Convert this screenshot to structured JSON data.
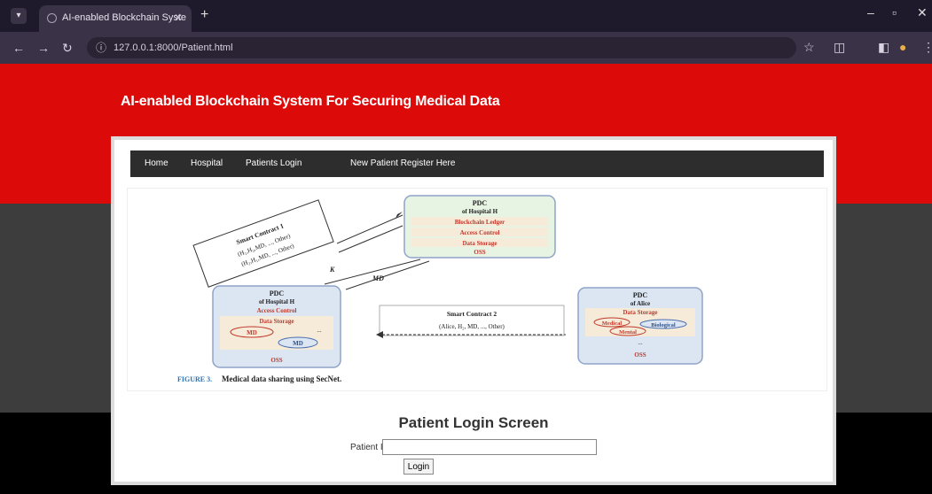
{
  "browser": {
    "tab_title": "AI-enabled Blockchain Syste",
    "url": "127.0.0.1:8000/Patient.html"
  },
  "site": {
    "title": "AI-enabled Blockchain System For Securing Medical Data"
  },
  "menu": {
    "items": [
      {
        "label": "Home"
      },
      {
        "label": "Hospital"
      },
      {
        "label": "Patients Login"
      },
      {
        "label": "New Patient Register Here"
      }
    ]
  },
  "figure": {
    "pdc_h1_title": "PDC",
    "pdc_h1_sub": "of Hospital H",
    "pdc_h1_rows": [
      "Blockchain Ledger",
      "Access Control",
      "Data Storage",
      "OSS"
    ],
    "pdc_h2_title": "PDC",
    "pdc_h2_sub": "of Hospital H",
    "pdc_h2_rows": [
      "Access Control",
      "Data Storage",
      "MD",
      "MD",
      "...",
      "OSS"
    ],
    "pdc_alice_title": "PDC",
    "pdc_alice_sub": "of Alice",
    "pdc_alice_rows": [
      "Data Storage",
      "Medical",
      "Biological",
      "Mental",
      "...",
      "OSS"
    ],
    "sc1_title": "Smart Contract 1",
    "sc1_line1": "(H₁,H₂,MD, ..., Other)",
    "sc1_line2": "(H₂,H₁,MD, ..., Other)",
    "sc2_title": "Smart Contract 2",
    "sc2_line": "(Alice, H₂, MD, ..., Other)",
    "arrow_label1": "K",
    "arrow_label2": "MD",
    "caption_prefix": "FIGURE 3.",
    "caption_text": "Medical data sharing using SecNet."
  },
  "login": {
    "title": "Patient Login Screen",
    "patient_id_label": "Patient ID",
    "patient_id_value": "",
    "login_button": "Login"
  }
}
